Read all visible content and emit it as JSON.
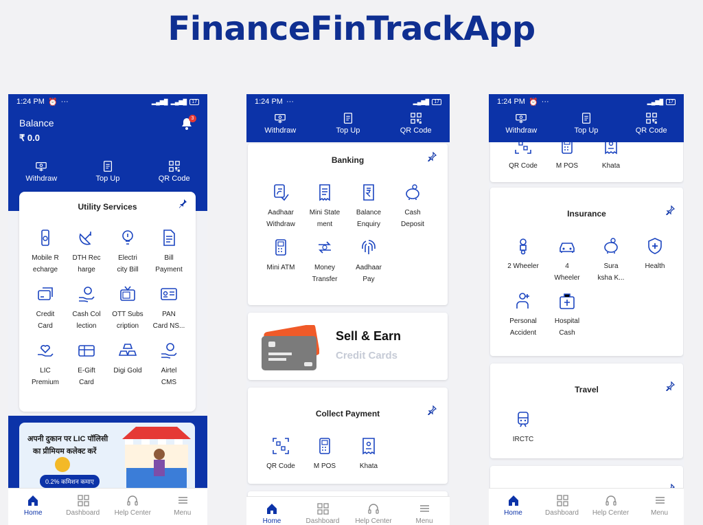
{
  "app_title": "FinanceFinTrackApp",
  "colors": {
    "brand_blue": "#0c33a8",
    "title_blue": "#0f2f91",
    "icon_blue": "#1a44c0",
    "badge_red": "#e53935"
  },
  "status_bar": {
    "time": "1:24 PM",
    "dots": "···",
    "battery": "17"
  },
  "actions": [
    {
      "label": "Withdraw",
      "icon": "withdraw-icon"
    },
    {
      "label": "Top Up",
      "icon": "topup-icon"
    },
    {
      "label": "QR Code",
      "icon": "qr-icon"
    }
  ],
  "phone1": {
    "balance_label": "Balance",
    "balance_value": "₹  0.0",
    "notification_count": "3",
    "utility": {
      "title": "Utility Services",
      "items": [
        {
          "line1": "Mobile R",
          "line2": "echarge",
          "icon": "mobile-icon"
        },
        {
          "line1": "DTH Rec",
          "line2": "harge",
          "icon": "dish-icon"
        },
        {
          "line1": "Electri",
          "line2": "city Bill",
          "icon": "bulb-icon"
        },
        {
          "line1": "Bill",
          "line2": "Payment",
          "icon": "bill-icon"
        },
        {
          "line1": "Credit",
          "line2": "Card",
          "icon": "card-icon"
        },
        {
          "line1": "Cash Col",
          "line2": "lection",
          "icon": "cash-hand-icon"
        },
        {
          "line1": "OTT Subs",
          "line2": "cription",
          "icon": "tv-icon"
        },
        {
          "line1": "PAN",
          "line2": "Card NS...",
          "icon": "id-card-icon"
        },
        {
          "line1": "LIC",
          "line2": "Premium",
          "icon": "heart-hand-icon"
        },
        {
          "line1": "E-Gift",
          "line2": "Card",
          "icon": "gift-card-icon"
        },
        {
          "line1": "Digi Gold",
          "line2": "",
          "icon": "gold-icon"
        },
        {
          "line1": "Airtel",
          "line2": "CMS",
          "icon": "cash-hand-icon"
        }
      ]
    },
    "banner": {
      "line1": "अपनी दुकान पर LIC पॉलिसी",
      "line2": "का प्रीमियम कलेक्ट करें",
      "badge": "0.2% कमिशन कमाए"
    }
  },
  "phone2": {
    "banking": {
      "title": "Banking",
      "items": [
        {
          "line1": "Aadhaar",
          "line2": "Withdraw",
          "icon": "fingerprint-card-icon"
        },
        {
          "line1": "Mini State",
          "line2": "ment",
          "icon": "receipt-icon"
        },
        {
          "line1": "Balance",
          "line2": "Enquiry",
          "icon": "rupee-doc-icon"
        },
        {
          "line1": "Cash",
          "line2": "Deposit",
          "icon": "piggy-icon"
        },
        {
          "line1": "Mini ATM",
          "line2": "",
          "icon": "pos-icon"
        },
        {
          "line1": "Money",
          "line2": "Transfer",
          "icon": "transfer-icon"
        },
        {
          "line1": "Aadhaar",
          "line2": "Pay",
          "icon": "fingerprint-icon"
        }
      ]
    },
    "sell": {
      "title": "Sell & Earn",
      "subtitle": "Credit Cards"
    },
    "collect": {
      "title": "Collect Payment",
      "items": [
        {
          "line1": "QR Code",
          "line2": "",
          "icon": "qr-scan-icon"
        },
        {
          "line1": "M POS",
          "line2": "",
          "icon": "pos-icon"
        },
        {
          "line1": "Khata",
          "line2": "",
          "icon": "khata-icon"
        }
      ]
    }
  },
  "phone3": {
    "top_items": [
      {
        "line1": "QR Code",
        "icon": "qr-scan-icon"
      },
      {
        "line1": "M POS",
        "icon": "pos-icon"
      },
      {
        "line1": "Khata",
        "icon": "khata-icon"
      }
    ],
    "insurance": {
      "title": "Insurance",
      "items": [
        {
          "line1": "2 Wheeler",
          "line2": "",
          "icon": "scooter-icon"
        },
        {
          "line1": "4",
          "line2": "Wheeler",
          "icon": "car-icon"
        },
        {
          "line1": "Sura",
          "line2": "ksha K...",
          "icon": "piggy-icon"
        },
        {
          "line1": "Health",
          "line2": "",
          "icon": "shield-plus-icon"
        },
        {
          "line1": "Personal",
          "line2": "Accident",
          "icon": "person-accident-icon"
        },
        {
          "line1": "Hospital",
          "line2": "Cash",
          "icon": "hospital-icon"
        }
      ]
    },
    "travel": {
      "title": "Travel",
      "items": [
        {
          "line1": "IRCTC",
          "line2": "",
          "icon": "train-icon"
        }
      ]
    }
  },
  "nav": [
    {
      "label": "Home",
      "icon": "home-icon"
    },
    {
      "label": "Dashboard",
      "icon": "dashboard-icon"
    },
    {
      "label": "Help Center",
      "icon": "headset-icon"
    },
    {
      "label": "Menu",
      "icon": "menu-icon"
    }
  ]
}
